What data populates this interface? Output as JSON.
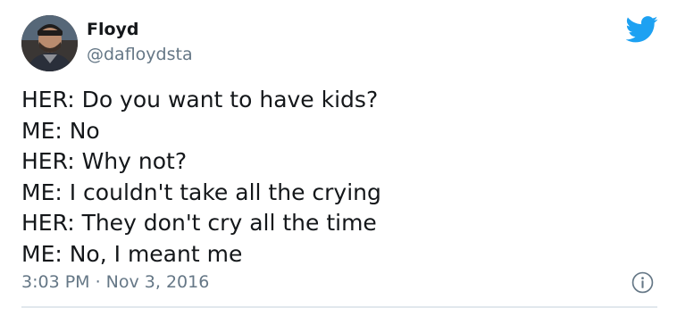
{
  "author": {
    "display_name": "Floyd",
    "handle": "@dafloydsta"
  },
  "tweet": {
    "lines": [
      "HER: Do you want to have kids?",
      "ME: No",
      "HER: Why not?",
      "ME: I couldn't take all the crying",
      "HER: They don't cry all the time",
      "ME: No, I meant me"
    ],
    "timestamp": "3:03 PM · Nov 3, 2016"
  },
  "icons": {
    "brand": "twitter-bird-icon",
    "info": "info-icon",
    "avatar": "profile-photo"
  },
  "colors": {
    "brand_blue": "#1da1f2",
    "text_primary": "#14171a",
    "text_secondary": "#657786",
    "divider": "#e1e8ed"
  }
}
